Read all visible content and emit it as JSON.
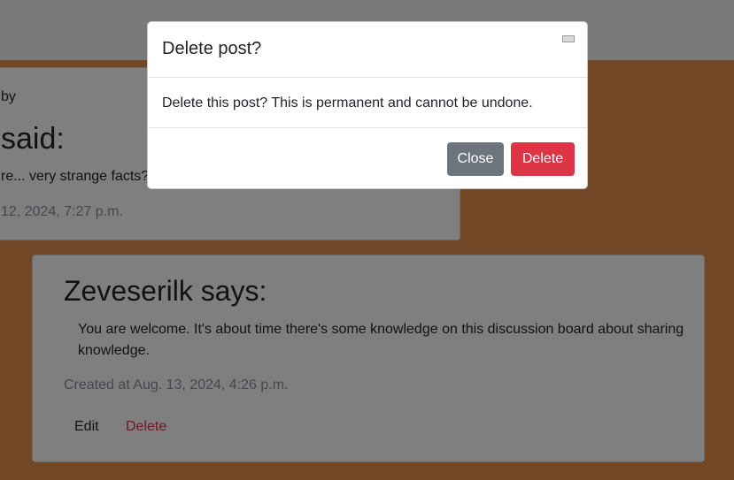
{
  "background": {
    "page_color": "#e58e4b",
    "band_color": "#f2f2f2"
  },
  "previous_comment": {
    "byline_fragment": "by",
    "heading_fragment": "said:",
    "body_fragment": "re... very strange facts? E",
    "timestamp_fragment": "12, 2024, 7:27 p.m."
  },
  "comment": {
    "author_heading": "Zeveserilk says:",
    "body": "You are welcome. It's about time there's some knowledge on this discussion board about sharing knowledge.",
    "created": "Created at Aug. 13, 2024, 4:26 p.m.",
    "edit_label": "Edit",
    "delete_label": "Delete"
  },
  "modal": {
    "title": "Delete post?",
    "message": "Delete this post? This is permanent and cannot be undone.",
    "close_label": "Close",
    "delete_label": "Delete",
    "close_icon": "close-icon",
    "colors": {
      "close_button": "#6c757d",
      "delete_button": "#dc3545"
    }
  }
}
